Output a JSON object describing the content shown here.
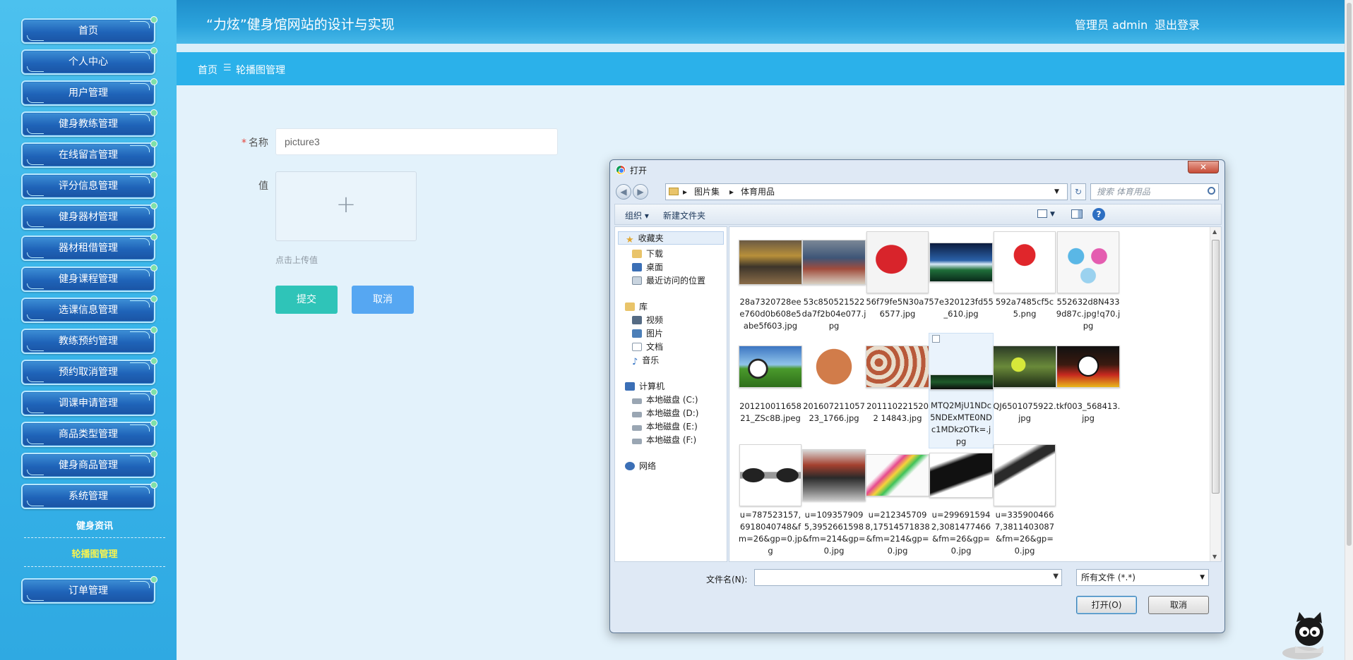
{
  "header": {
    "title": "“力炫”健身馆网站的设计与实现",
    "user": "管理员 admin",
    "logout": "退出登录"
  },
  "breadcrumb": {
    "home": "首页",
    "separator": "☰",
    "current": "轮播图管理"
  },
  "sidebar": {
    "items": [
      "首页",
      "个人中心",
      "用户管理",
      "健身教练管理",
      "在线留言管理",
      "评分信息管理",
      "健身器材管理",
      "器材租借管理",
      "健身课程管理",
      "选课信息管理",
      "教练预约管理",
      "预约取消管理",
      "调课申请管理",
      "商品类型管理",
      "健身商品管理",
      "系统管理"
    ],
    "sub_items": [
      {
        "label": "健身资讯",
        "active": false
      },
      {
        "label": "轮播图管理",
        "active": true
      }
    ],
    "last_item": "订单管理"
  },
  "form": {
    "name_label": "名称",
    "name_value": "picture3",
    "value_label": "值",
    "upload_plus": "+",
    "upload_hint": "点击上传值",
    "submit": "提交",
    "cancel": "取消"
  },
  "dialog": {
    "title": "打开",
    "close": "✕",
    "back": "◀",
    "forward": "▶",
    "path": [
      "图片集",
      "体育用品"
    ],
    "path_separator": "▸",
    "refresh": "↻",
    "search_placeholder": "搜索 体育用品",
    "toolbar": {
      "organize": "组织 ▾",
      "new_folder": "新建文件夹",
      "help": "?"
    },
    "tree": {
      "favorites": "收藏夹",
      "favorite_items": [
        "下载",
        "桌面",
        "最近访问的位置"
      ],
      "library": "库",
      "library_items": [
        "视频",
        "图片",
        "文档",
        "音乐"
      ],
      "computer": "计算机",
      "drives": [
        "本地磁盘 (C:)",
        "本地磁盘 (D:)",
        "本地磁盘 (E:)",
        "本地磁盘 (F:)"
      ],
      "network": "网络"
    },
    "files": [
      "28a7320728eee760d0b608e5abe5f603.jpg",
      "53c850521522da7f2b04e077.jpg",
      "56f79fe5N30a76577.jpg",
      "57e320123fd55_610.jpg",
      "592a7485cf5c5.png",
      "552632d8N4339d87c.jpg!q70.jpg",
      "20121001165821_ZSc8B.jpeg",
      "20160721105723_1766.jpg",
      "2011102215202 14843.jpg",
      "MTQ2MjU1NDc5NDExMTE0NDc1MDkzOTk=.jpg",
      "QJ6501075922.jpg",
      "tkf003_568413.jpg",
      "u=787523157,6918040748&fm=26&gp=0.jpg",
      "u=1093579095,3952661598&fm=214&gp=0.jpg",
      "u=2123457098,17514571838&fm=214&gp=0.jpg",
      "u=2996915942,3081477466&fm=26&gp=0.jpg",
      "u=3359004667,3811403087&fm=26&gp=0.jpg"
    ],
    "filename_label": "文件名(N):",
    "filename_value": "",
    "filetype": "所有文件 (*.*)",
    "open": "打开(O)",
    "cancel": "取消"
  },
  "colors": {
    "sidebar_bg": "#38b5ea",
    "header_bg": "#2ba3dc",
    "breadcrumb_bg": "#2bb1ea",
    "submit_btn": "#2fc4b8",
    "cancel_btn": "#56a7f2",
    "active_sub_item": "#f7f350"
  }
}
